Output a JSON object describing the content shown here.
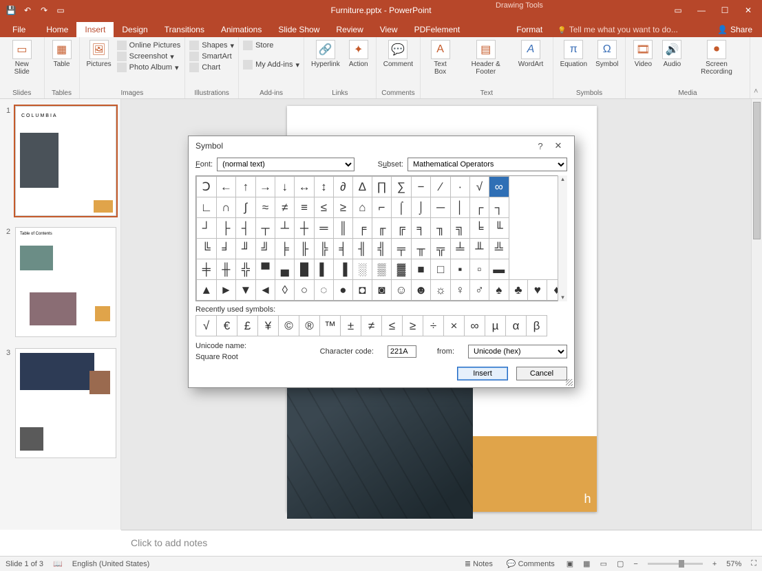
{
  "titlebar": {
    "title": "Furniture.pptx - PowerPoint",
    "context_tab": "Drawing Tools"
  },
  "menu": {
    "tabs": [
      "File",
      "Home",
      "Insert",
      "Design",
      "Transitions",
      "Animations",
      "Slide Show",
      "Review",
      "View",
      "PDFelement",
      "Format"
    ],
    "active_index": 2,
    "tell_me": "Tell me what you want to do...",
    "share": "Share"
  },
  "ribbon": {
    "groups": {
      "slides": {
        "label": "Slides",
        "new_slide": "New\nSlide"
      },
      "tables": {
        "label": "Tables",
        "table": "Table"
      },
      "images": {
        "label": "Images",
        "pictures": "Pictures",
        "online_pictures": "Online Pictures",
        "screenshot": "Screenshot",
        "photo_album": "Photo Album"
      },
      "illustrations": {
        "label": "Illustrations",
        "shapes": "Shapes",
        "smartart": "SmartArt",
        "chart": "Chart"
      },
      "addins": {
        "label": "Add-ins",
        "store": "Store",
        "my_addins": "My Add-ins"
      },
      "links": {
        "label": "Links",
        "hyperlink": "Hyperlink",
        "action": "Action"
      },
      "comments": {
        "label": "Comments",
        "comment": "Comment"
      },
      "text": {
        "label": "Text",
        "text_box": "Text\nBox",
        "header_footer": "Header\n& Footer",
        "wordart": "WordArt"
      },
      "symbols": {
        "label": "Symbols",
        "equation": "Equation",
        "symbol": "Symbol"
      },
      "media": {
        "label": "Media",
        "video": "Video",
        "audio": "Audio",
        "screen_recording": "Screen\nRecording"
      }
    }
  },
  "dialog": {
    "title": "Symbol",
    "font_label": "Font:",
    "font_value": "(normal text)",
    "subset_label": "Subset:",
    "subset_value": "Mathematical Operators",
    "selected_row": 0,
    "selected_col": 15,
    "grid": [
      [
        "Ↄ",
        "←",
        "↑",
        "→",
        "↓",
        "↔",
        "↕",
        "∂",
        "∆",
        "∏",
        "∑",
        "−",
        "∕",
        "∙",
        "√",
        "∞"
      ],
      [
        "∟",
        "∩",
        "∫",
        "≈",
        "≠",
        "≡",
        "≤",
        "≥",
        "⌂",
        "⌐",
        "⌠",
        "⌡",
        "─",
        "│",
        "┌",
        "┐"
      ],
      [
        "┘",
        "├",
        "┤",
        "┬",
        "┴",
        "┼",
        "═",
        "║",
        "╒",
        "╓",
        "╔",
        "╕",
        "╖",
        "╗",
        "╘",
        "╙"
      ],
      [
        "╚",
        "╛",
        "╜",
        "╝",
        "╞",
        "╟",
        "╠",
        "╡",
        "╢",
        "╣",
        "╤",
        "╥",
        "╦",
        "╧",
        "╨",
        "╩"
      ],
      [
        "╪",
        "╫",
        "╬",
        "▀",
        "▄",
        "█",
        "▌",
        "▐",
        "░",
        "▒",
        "▓",
        "■",
        "□",
        "▪",
        "▫",
        "▬"
      ],
      [
        "▲",
        "►",
        "▼",
        "◄",
        "◊",
        "○",
        "◌",
        "●",
        "◘",
        "◙",
        "☺",
        "☻",
        "☼",
        "♀",
        "♂",
        "♠"
      ]
    ],
    "grid_last_partial": [
      "♣",
      "♥",
      "♦"
    ],
    "recent_label": "Recently used symbols:",
    "recent": [
      "√",
      "€",
      "£",
      "¥",
      "©",
      "®",
      "™",
      "±",
      "≠",
      "≤",
      "≥",
      "÷",
      "×",
      "∞",
      "µ",
      "α",
      "β"
    ],
    "unicode_name_label": "Unicode name:",
    "unicode_name": "Square Root",
    "char_code_label": "Character code:",
    "char_code": "221A",
    "from_label": "from:",
    "from_value": "Unicode (hex)",
    "insert_btn": "Insert",
    "cancel_btn": "Cancel"
  },
  "notes_placeholder": "Click to add notes",
  "status": {
    "slide_pos": "Slide 1 of 3",
    "language": "English (United States)",
    "notes_btn": "Notes",
    "comments_btn": "Comments",
    "zoom_pct": "57%"
  },
  "thumbs": {
    "t1_title": "COLUMBIA",
    "t2_title": "Table of Contents"
  }
}
